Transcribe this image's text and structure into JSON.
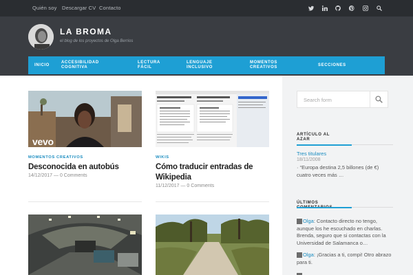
{
  "topbar": {
    "links": [
      "Quién soy",
      "Descargar CV",
      "Contacto"
    ],
    "social_icons": [
      "twitter-icon",
      "linkedin-icon",
      "github-icon",
      "pinterest-icon",
      "instagram-icon",
      "search-icon"
    ]
  },
  "header": {
    "title": "LA BROMA",
    "description": "el blog de los proyectos de Olga Berrios"
  },
  "nav": {
    "items": [
      "INICIO",
      "ACCESIBILIDAD COGNITIVA",
      "LECTURA FÁCIL",
      "LENGUAJE INCLUSIVO",
      "MOMENTOS CREATIVOS",
      "SECCIONES"
    ]
  },
  "posts": [
    {
      "category": "MOMENTOS CREATIVOS",
      "title": "Desconocida en autobús",
      "date": "14/12/2017",
      "comments": "0 Comments",
      "thumb_badge": "vevo"
    },
    {
      "category": "WIKIS",
      "title": "Cómo traducir entradas de Wikipedia",
      "date": "11/12/2017",
      "comments": "0 Comments",
      "thumb_badge": ""
    },
    {
      "category": "",
      "title": "",
      "date": "",
      "comments": "",
      "thumb_badge": ""
    },
    {
      "category": "",
      "title": "",
      "date": "",
      "comments": "",
      "thumb_badge": ""
    }
  ],
  "sidebar": {
    "search_placeholder": "Search form",
    "random": {
      "title": "ARTÍCULO AL AZAR",
      "link": "Tres titulares",
      "date": "18/11/2008",
      "excerpt": "· “Europa destina 2,5 billones (de €) cuatro veces más …"
    },
    "comments": {
      "title": "ÚLTIMOS COMENTARIOS",
      "items": [
        {
          "author": "Olga",
          "text": ": Contacto directo no tengo, aunque los he escuchado en charlas. Brenda, seguro que si contactas con la Universidad de Salamanca o…"
        },
        {
          "author": "Olga",
          "text": ": ¡Gracias a ti, compi! Otro abrazo para ti."
        }
      ]
    }
  },
  "colors": {
    "accent": "#1e9fd4",
    "topbar": "#2a2d31",
    "header": "#3a3d42",
    "link": "#1a8cc0"
  }
}
